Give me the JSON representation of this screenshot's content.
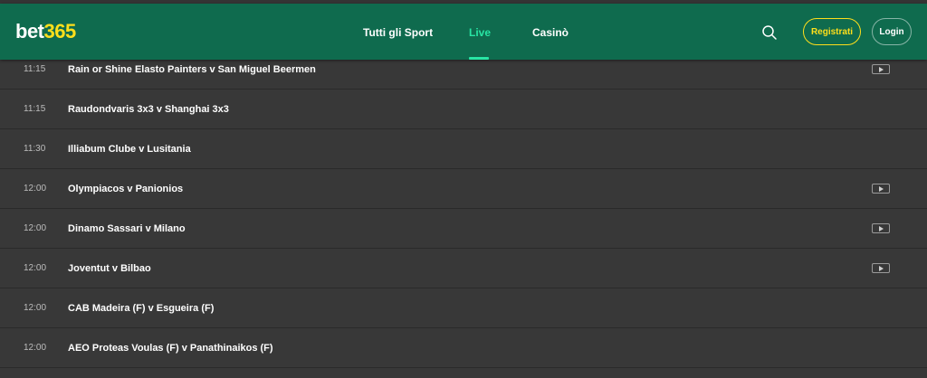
{
  "header": {
    "logo_part1": "bet",
    "logo_part2": "365",
    "nav": [
      {
        "label": "Tutti gli Sport",
        "active": false
      },
      {
        "label": "Live",
        "active": true
      },
      {
        "label": "Casinò",
        "active": false
      }
    ],
    "register_label": "Registrati",
    "login_label": "Login",
    "search_icon": "search-icon"
  },
  "colors": {
    "header_bg": "#0f6b4e",
    "accent_green": "#28e5a4",
    "brand_yellow": "#ffdf1b",
    "page_bg": "#383838"
  },
  "events": [
    {
      "time": "11:15",
      "match": "Rain or Shine Elasto Painters v San Miguel Beermen",
      "video": true
    },
    {
      "time": "11:15",
      "match": "Raudondvaris 3x3 v Shanghai 3x3",
      "video": false
    },
    {
      "time": "11:30",
      "match": "Illiabum Clube v Lusitania",
      "video": false
    },
    {
      "time": "12:00",
      "match": "Olympiacos v Panionios",
      "video": true
    },
    {
      "time": "12:00",
      "match": "Dinamo Sassari v Milano",
      "video": true
    },
    {
      "time": "12:00",
      "match": "Joventut v Bilbao",
      "video": true
    },
    {
      "time": "12:00",
      "match": "CAB Madeira (F) v Esgueira (F)",
      "video": false
    },
    {
      "time": "12:00",
      "match": "AEO Proteas Voulas (F) v Panathinaikos (F)",
      "video": false
    }
  ]
}
